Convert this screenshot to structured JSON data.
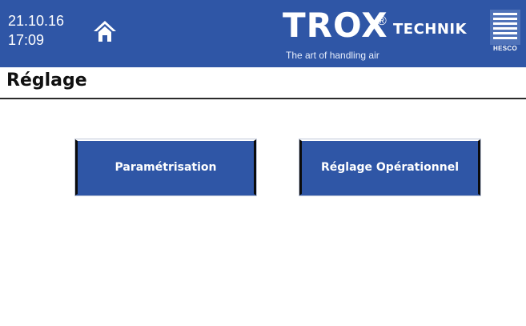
{
  "header": {
    "date": "21.10.16",
    "time": "17:09",
    "brand": {
      "name": "TROX",
      "registered_mark": "®",
      "suffix": "TECHNIK",
      "slogan": "The art of handling air"
    },
    "partner_logo_text": "HESCO",
    "icons": {
      "home": "home-icon",
      "partner": "hesco-logo"
    },
    "colors": {
      "header_bg": "#2f56a6",
      "button_bg": "#2f56a6",
      "text_on_blue": "#ffffff"
    }
  },
  "page": {
    "title": "Réglage"
  },
  "menu": {
    "buttons": [
      {
        "label": "Paramétrisation"
      },
      {
        "label": "Réglage Opérationnel"
      }
    ]
  }
}
